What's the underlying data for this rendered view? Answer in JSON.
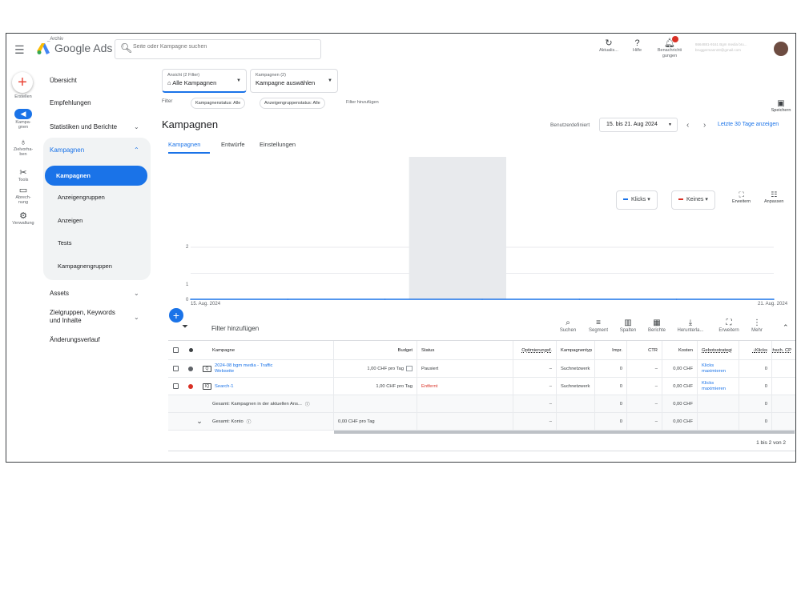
{
  "header": {
    "archive_label": "_Archiv",
    "brand": "Google Ads",
    "search_placeholder": "Seite oder Kampagne suchen",
    "refresh_label": "Aktualis...",
    "help_label": "Hilfe",
    "notifications_label": "Benachrichti gungen",
    "account_name": "8664881-9161 Bgm media bru...",
    "account_email": "bruggermann33@gmail.com"
  },
  "rail": [
    {
      "label": "Erstellen",
      "icon": "plus-icon"
    },
    {
      "label": "Kampa-gnen",
      "icon": "campaign-icon"
    },
    {
      "label": "Zielvorha-ben",
      "icon": "trophy-icon"
    },
    {
      "label": "Tools",
      "icon": "tools-icon"
    },
    {
      "label": "Abrech-nung",
      "icon": "billing-icon"
    },
    {
      "label": "Verwaltung",
      "icon": "admin-icon"
    }
  ],
  "nav": {
    "overview": "Übersicht",
    "recommendations": "Empfehlungen",
    "stats": "Statistiken und Berichte",
    "campaigns_group": "Kampagnen",
    "sub": [
      "Kampagnen",
      "Anzeigengruppen",
      "Anzeigen",
      "Tests",
      "Kampagnengruppen"
    ],
    "assets": "Assets",
    "audiences": "Zielgruppen, Keywords und Inhalte",
    "history": "Änderungsverlauf"
  },
  "filters": {
    "view_sub": "Ansicht (2 Filter)",
    "view_main": "Alle Kampagnen",
    "campaigns_sub": "Kampagnen (2)",
    "campaigns_main": "Kampagne auswählen",
    "filter_label": "Filter",
    "chip1": "Kampagnenstatus: Alle",
    "chip2": "Anzeigengruppenstatus: Alle",
    "add_filter": "Filter hinzufügen",
    "save": "Speichern"
  },
  "page": {
    "title": "Kampagnen",
    "date_label": "Benutzerdefiniert",
    "date_range": "15. bis 21. Aug 2024",
    "last30": "Letzte 30 Tage anzeigen",
    "tabs": [
      "Kampagnen",
      "Entwürfe",
      "Einstellungen"
    ]
  },
  "chart_controls": {
    "metric1": "Klicks",
    "metric2": "Keines",
    "expand": "Erweitern",
    "adjust": "Anpassen"
  },
  "chart_data": {
    "type": "line",
    "x": [
      "15. Aug. 2024",
      "16. Aug. 2024",
      "17. Aug. 2024",
      "18. Aug. 2024",
      "19. Aug. 2024",
      "20. Aug. 2024",
      "21. Aug. 2024"
    ],
    "x_tick_labels": [
      "15. Aug. 2024",
      "21. Aug. 2024"
    ],
    "series": [
      {
        "name": "Klicks",
        "values": [
          0,
          0,
          0,
          0,
          0,
          0,
          0
        ]
      }
    ],
    "ylim": [
      0,
      2
    ],
    "y_ticks": [
      "2",
      "1",
      "0"
    ],
    "highlight_range": [
      "17. Aug. 2024",
      "18. Aug. 2024"
    ],
    "series_color": "#1a73e8",
    "grid": true
  },
  "table_toolbar": {
    "add_filter": "Filter hinzufügen",
    "tools": [
      "Suchen",
      "Segment",
      "Spalten",
      "Berichte",
      "Herunterla...",
      "Erweitern",
      "Mehr"
    ]
  },
  "table": {
    "headers": [
      "Kampagne",
      "Budget",
      "Status",
      "Optimierungsf.",
      "Kampagnentyp",
      "Impr.",
      "CTR",
      "Kosten",
      "Gebotsstrategi",
      "Klicks",
      "Durchsch. CP"
    ],
    "rows": [
      {
        "campaign": "2024-08 bgm media - Traffic Webseite",
        "budget": "1,00 CHF pro Tag",
        "status": "Pausiert",
        "opt": "–",
        "type": "Suchnetzwerk",
        "impr": "0",
        "ctr": "–",
        "cost": "0,00 CHF",
        "bid": "Klicks maximieren",
        "clicks": "0",
        "status_color": "#5f6368"
      },
      {
        "campaign": "Search-1",
        "budget": "1,00 CHF pro Tag",
        "status": "Entfernt",
        "opt": "–",
        "type": "Suchnetzwerk",
        "impr": "0",
        "ctr": "–",
        "cost": "0,00 CHF",
        "bid": "Klicks maximieren",
        "clicks": "0",
        "status_color": "#d93025"
      }
    ],
    "total_current": {
      "label": "Gesamt: Kampagnen in der aktuellen Ans...",
      "opt": "–",
      "impr": "0",
      "ctr": "–",
      "cost": "0,00 CHF",
      "clicks": "0"
    },
    "total_account": {
      "label": "Gesamt: Konto",
      "budget": "0,00 CHF pro Tag",
      "opt": "–",
      "impr": "0",
      "ctr": "–",
      "cost": "0,00 CHF",
      "clicks": "0"
    },
    "pager": "1 bis 2 von 2"
  }
}
